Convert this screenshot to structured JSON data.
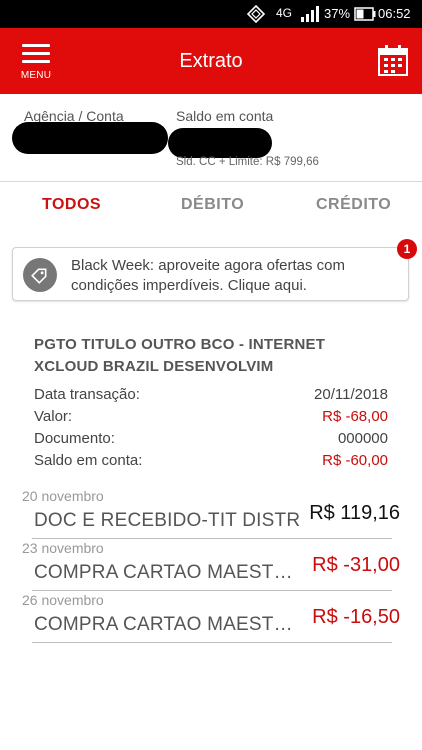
{
  "status_bar": {
    "network": "4G",
    "battery_percent": "37%",
    "time": "06:52"
  },
  "app_bar": {
    "menu_label": "MENU",
    "title": "Extrato"
  },
  "account": {
    "agency_label": "Agência / Conta",
    "balance_label": "Saldo em conta",
    "limit_text": "Sld. CC + Limite: R$ 799,66"
  },
  "tabs": [
    {
      "label": "TODOS",
      "active": true
    },
    {
      "label": "DÉBITO",
      "active": false
    },
    {
      "label": "CRÉDITO",
      "active": false
    }
  ],
  "promo": {
    "text": "Black Week: aproveite agora ofertas com condições imperdíveis. Clique aqui.",
    "badge_count": "1"
  },
  "detail": {
    "title_line1": "PGTO TITULO OUTRO BCO - INTERNET",
    "title_line2": "XCLOUD BRAZIL DESENVOLVIM",
    "fields": [
      {
        "label": "Data transação:",
        "value": "20/11/2018",
        "negative": false
      },
      {
        "label": "Valor:",
        "value": "R$ -68,00",
        "negative": true
      },
      {
        "label": "Documento:",
        "value": "000000",
        "negative": false
      },
      {
        "label": "Saldo em conta:",
        "value": "R$ -60,00",
        "negative": true
      }
    ]
  },
  "transactions": [
    {
      "date": "20 novembro",
      "description": "DOC E RECEBIDO-TIT DISTR",
      "amount": "R$ 119,16",
      "negative": false
    },
    {
      "date": "23 novembro",
      "description": "COMPRA CARTAO MAESTRO",
      "amount": "R$ -31,00",
      "negative": true
    },
    {
      "date": "26 novembro",
      "description": "COMPRA CARTAO MAESTRO",
      "amount": "R$ -16,50",
      "negative": true
    }
  ],
  "colors": {
    "brand_red": "#e00b0b",
    "negative_red": "#c80d0d"
  }
}
